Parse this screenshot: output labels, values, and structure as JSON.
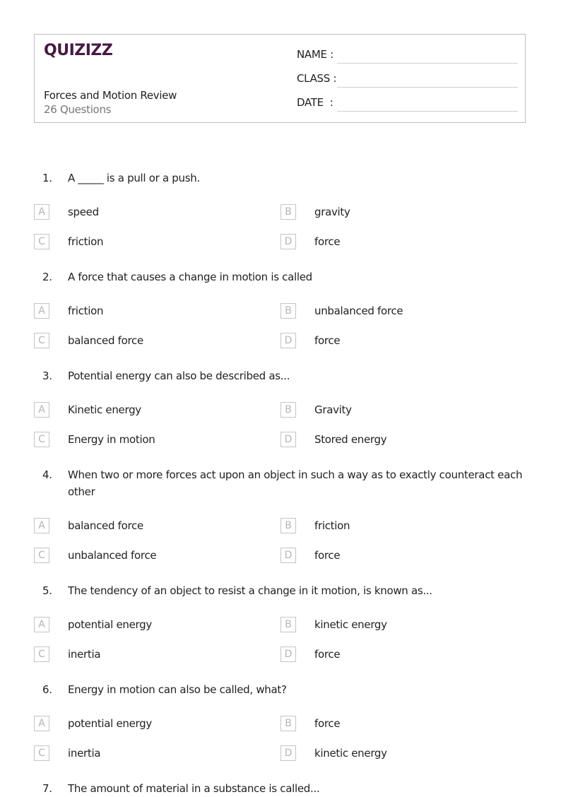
{
  "header": {
    "logo": "QUIZIZZ",
    "title": "Forces and Motion Review",
    "subtitle": "26 Questions",
    "fields": [
      {
        "label": "NAME :"
      },
      {
        "label": "CLASS :"
      },
      {
        "label": "DATE  :"
      }
    ]
  },
  "questions": [
    {
      "number": "1.",
      "text": "A _____ is a pull or a push.",
      "options": [
        {
          "letter": "A",
          "text": "speed"
        },
        {
          "letter": "B",
          "text": "gravity"
        },
        {
          "letter": "C",
          "text": "friction"
        },
        {
          "letter": "D",
          "text": "force"
        }
      ]
    },
    {
      "number": "2.",
      "text": "A force that causes a change in motion is called",
      "options": [
        {
          "letter": "A",
          "text": "friction"
        },
        {
          "letter": "B",
          "text": "unbalanced force"
        },
        {
          "letter": "C",
          "text": "balanced force"
        },
        {
          "letter": "D",
          "text": "force"
        }
      ]
    },
    {
      "number": "3.",
      "text": "Potential energy can also be described as...",
      "options": [
        {
          "letter": "A",
          "text": "Kinetic energy"
        },
        {
          "letter": "B",
          "text": "Gravity"
        },
        {
          "letter": "C",
          "text": "Energy in motion"
        },
        {
          "letter": "D",
          "text": "Stored energy"
        }
      ]
    },
    {
      "number": "4.",
      "text": "When two or more forces act upon an object in such a way as to exactly counteract each other",
      "options": [
        {
          "letter": "A",
          "text": "balanced force"
        },
        {
          "letter": "B",
          "text": "friction"
        },
        {
          "letter": "C",
          "text": "unbalanced force"
        },
        {
          "letter": "D",
          "text": "force"
        }
      ]
    },
    {
      "number": "5.",
      "text": "The tendency of an object to resist a change in it motion, is known as...",
      "options": [
        {
          "letter": "A",
          "text": "potential energy"
        },
        {
          "letter": "B",
          "text": "kinetic energy"
        },
        {
          "letter": "C",
          "text": "inertia"
        },
        {
          "letter": "D",
          "text": "force"
        }
      ]
    },
    {
      "number": "6.",
      "text": "Energy in motion can also be called, what?",
      "options": [
        {
          "letter": "A",
          "text": "potential energy"
        },
        {
          "letter": "B",
          "text": "force"
        },
        {
          "letter": "C",
          "text": "inertia"
        },
        {
          "letter": "D",
          "text": "kinetic energy"
        }
      ]
    },
    {
      "number": "7.",
      "text": "The amount of material in a substance is called...",
      "options": []
    }
  ]
}
